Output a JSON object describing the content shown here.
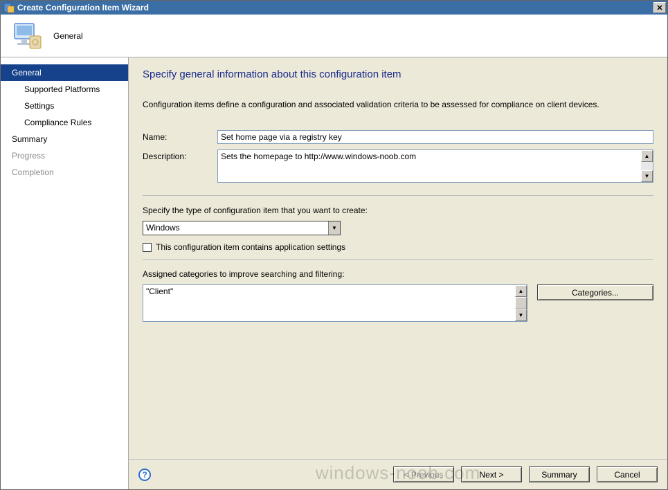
{
  "window": {
    "title": "Create Configuration Item Wizard"
  },
  "banner": {
    "title": "General"
  },
  "nav": {
    "items": [
      {
        "label": "General",
        "selected": true,
        "enabled": true,
        "sub": false
      },
      {
        "label": "Supported Platforms",
        "selected": false,
        "enabled": true,
        "sub": true
      },
      {
        "label": "Settings",
        "selected": false,
        "enabled": true,
        "sub": true
      },
      {
        "label": "Compliance Rules",
        "selected": false,
        "enabled": true,
        "sub": true
      },
      {
        "label": "Summary",
        "selected": false,
        "enabled": true,
        "sub": false
      },
      {
        "label": "Progress",
        "selected": false,
        "enabled": false,
        "sub": false
      },
      {
        "label": "Completion",
        "selected": false,
        "enabled": false,
        "sub": false
      }
    ]
  },
  "content": {
    "heading": "Specify general information about this configuration item",
    "intro": "Configuration items define a configuration and associated validation criteria to be assessed for compliance on client devices.",
    "name_label": "Name:",
    "name_value": "Set home page via a registry key",
    "description_label": "Description:",
    "description_value": "Sets the homepage to http://www.windows-noob.com",
    "type_label": "Specify the type of configuration item that you want to create:",
    "type_value": "Windows",
    "app_settings_label": "This configuration item contains application settings",
    "app_settings_checked": false,
    "categories_label": "Assigned categories to improve searching and filtering:",
    "categories_value": "\"Client\"",
    "categories_button": "Categories..."
  },
  "footer": {
    "previous": "< Previous",
    "next": "Next >",
    "summary": "Summary",
    "cancel": "Cancel"
  },
  "watermark": "windows-noob.com"
}
